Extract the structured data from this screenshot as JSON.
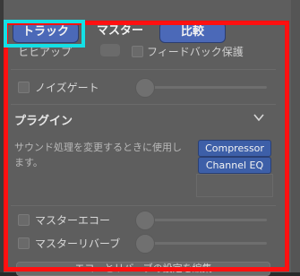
{
  "tabs": {
    "track": "トラック",
    "master": "マスター",
    "compare": "比較"
  },
  "top_row": {
    "label": "ヒヒアップ",
    "feedback_protection": "フィードバック保護"
  },
  "noise_gate": {
    "label": "ノイズゲート"
  },
  "plugins": {
    "title": "プラグイン",
    "description": "サウンド処理を変更するときに使用します。",
    "items": [
      "Compressor",
      "Channel EQ"
    ]
  },
  "master_echo": {
    "label": "マスターエコー"
  },
  "master_reverb": {
    "label": "マスターリバーブ"
  },
  "bottom_button": {
    "label": "エコーとリバーブの設定を編集"
  }
}
